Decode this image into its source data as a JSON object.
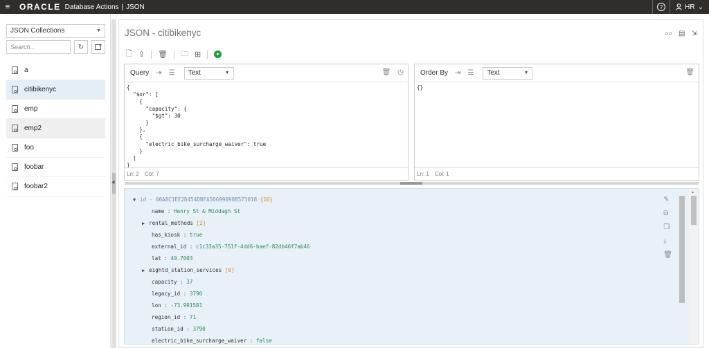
{
  "topbar": {
    "menu_icon": "≡",
    "brand": "ORACLE",
    "product": "Database Actions",
    "separator": "|",
    "page": "JSON",
    "help_icon": "?",
    "user_icon": "user-icon",
    "user": "HR",
    "user_caret": "⌄"
  },
  "sidebar": {
    "collections_select": "JSON Collections",
    "search_placeholder": "Search...",
    "collections": [
      {
        "label": "a"
      },
      {
        "label": "citibikenyc"
      },
      {
        "label": "emp"
      },
      {
        "label": "emp2"
      },
      {
        "label": "foo"
      },
      {
        "label": "foobar"
      },
      {
        "label": "foobar2"
      }
    ]
  },
  "main": {
    "title": "JSON - citibikenyc"
  },
  "query_pane": {
    "label": "Query",
    "type": "Text",
    "code": "{\n  \"$or\": [\n    {\n      \"capacity\": {\n        \"$gt\": 30\n      }\n    },\n    {\n      \"electric_bike_surcharge_waiver\": true\n    }\n  ]\n}",
    "ln": "Ln: 2",
    "col": "Col: 7"
  },
  "order_pane": {
    "label": "Order By",
    "type": "Text",
    "code": "{}",
    "ln": "Ln: 1",
    "col": "Col: 1"
  },
  "results": {
    "id_key": "id",
    "id_dash": "-",
    "id_value": "00A8C1EE2D454DBFA56699898B573018",
    "id_count": "{16}",
    "fields": [
      {
        "key": "name",
        "value": "Henry St & Middagh St",
        "kind": "str"
      },
      {
        "key": "rental_methods",
        "value": "[2]",
        "kind": "cnt",
        "expand": true
      },
      {
        "key": "has_kiosk",
        "value": "true",
        "kind": "kw"
      },
      {
        "key": "external_id",
        "value": "c1c33a35-751f-4dd6-baef-82db46f7ab46",
        "kind": "str"
      },
      {
        "key": "lat",
        "value": "40.7003",
        "kind": "num",
        "pad": true
      },
      {
        "key": "eightd_station_services",
        "value": "[0]",
        "kind": "cnt",
        "expand": true
      },
      {
        "key": "capacity",
        "value": "37",
        "kind": "num"
      },
      {
        "key": "legacy_id",
        "value": "3790",
        "kind": "str"
      },
      {
        "key": "lon",
        "value": "-73.991581",
        "kind": "num",
        "pad": true
      },
      {
        "key": "region_id",
        "value": "71",
        "kind": "str"
      },
      {
        "key": "station_id",
        "value": "3790",
        "kind": "str"
      },
      {
        "key": "electric_bike_surcharge_waiver",
        "value": "false",
        "kind": "kw"
      }
    ]
  }
}
